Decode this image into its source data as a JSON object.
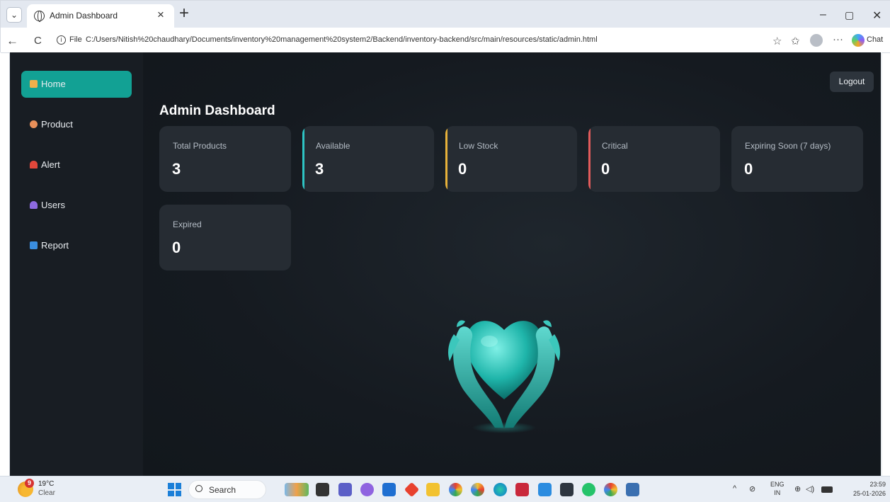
{
  "browser": {
    "tab_title": "Admin Dashboard",
    "file_label": "File",
    "url": "C:/Users/Nitish%20chaudhary/Documents/inventory%20management%20system2/Backend/inventory-backend/src/main/resources/static/admin.html",
    "chat_label": "Chat"
  },
  "sidebar": {
    "items": [
      {
        "label": "Home",
        "icon": "house-icon",
        "color": "#f0b04a",
        "active": true
      },
      {
        "label": "Product",
        "icon": "box-icon",
        "color": "#e8905a",
        "active": false
      },
      {
        "label": "Alert",
        "icon": "siren-icon",
        "color": "#e2473b",
        "active": false
      },
      {
        "label": "Users",
        "icon": "user-icon",
        "color": "#8e6be0",
        "active": false
      },
      {
        "label": "Report",
        "icon": "bar-chart-icon",
        "color": "#3a8ee0",
        "active": false
      }
    ]
  },
  "header": {
    "logout_label": "Logout",
    "page_title": "Admin Dashboard"
  },
  "cards": [
    {
      "label": "Total Products",
      "value": "3",
      "accent": ""
    },
    {
      "label": "Available",
      "value": "3",
      "accent": "#2ec4c4"
    },
    {
      "label": "Low Stock",
      "value": "0",
      "accent": "#e8b23a"
    },
    {
      "label": "Critical",
      "value": "0",
      "accent": "#e25b5b"
    },
    {
      "label": "Expiring Soon (7 days)",
      "value": "0",
      "accent": ""
    },
    {
      "label": "Expired",
      "value": "0",
      "accent": ""
    }
  ],
  "taskbar": {
    "weather_badge": "9",
    "temperature": "19°C",
    "condition": "Clear",
    "search_label": "Search",
    "lang_top": "ENG",
    "lang_bottom": "IN",
    "time": "23:59",
    "date": "25-01-2026"
  }
}
